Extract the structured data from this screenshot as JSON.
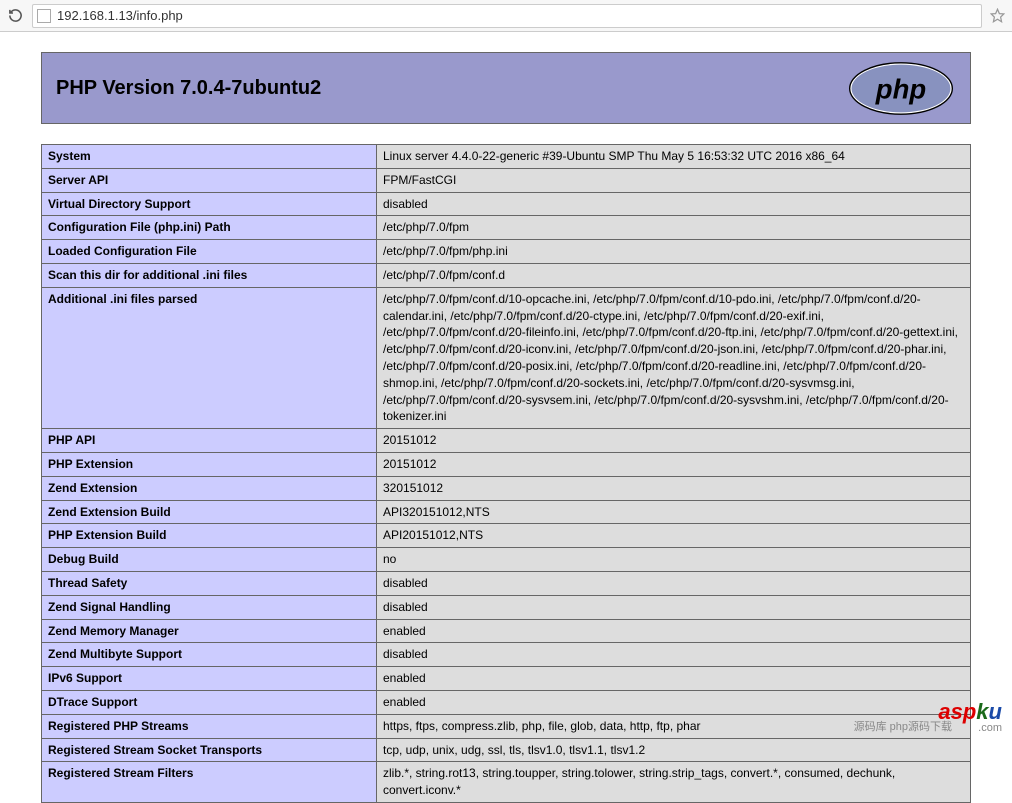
{
  "browser": {
    "url": "192.168.1.13/info.php"
  },
  "header": {
    "title": "PHP Version 7.0.4-7ubuntu2"
  },
  "rows": [
    {
      "k": "System",
      "v": "Linux server 4.4.0-22-generic #39-Ubuntu SMP Thu May 5 16:53:32 UTC 2016 x86_64"
    },
    {
      "k": "Server API",
      "v": "FPM/FastCGI"
    },
    {
      "k": "Virtual Directory Support",
      "v": "disabled"
    },
    {
      "k": "Configuration File (php.ini) Path",
      "v": "/etc/php/7.0/fpm"
    },
    {
      "k": "Loaded Configuration File",
      "v": "/etc/php/7.0/fpm/php.ini"
    },
    {
      "k": "Scan this dir for additional .ini files",
      "v": "/etc/php/7.0/fpm/conf.d"
    },
    {
      "k": "Additional .ini files parsed",
      "v": "/etc/php/7.0/fpm/conf.d/10-opcache.ini, /etc/php/7.0/fpm/conf.d/10-pdo.ini, /etc/php/7.0/fpm/conf.d/20-calendar.ini, /etc/php/7.0/fpm/conf.d/20-ctype.ini, /etc/php/7.0/fpm/conf.d/20-exif.ini, /etc/php/7.0/fpm/conf.d/20-fileinfo.ini, /etc/php/7.0/fpm/conf.d/20-ftp.ini, /etc/php/7.0/fpm/conf.d/20-gettext.ini, /etc/php/7.0/fpm/conf.d/20-iconv.ini, /etc/php/7.0/fpm/conf.d/20-json.ini, /etc/php/7.0/fpm/conf.d/20-phar.ini, /etc/php/7.0/fpm/conf.d/20-posix.ini, /etc/php/7.0/fpm/conf.d/20-readline.ini, /etc/php/7.0/fpm/conf.d/20-shmop.ini, /etc/php/7.0/fpm/conf.d/20-sockets.ini, /etc/php/7.0/fpm/conf.d/20-sysvmsg.ini, /etc/php/7.0/fpm/conf.d/20-sysvsem.ini, /etc/php/7.0/fpm/conf.d/20-sysvshm.ini, /etc/php/7.0/fpm/conf.d/20-tokenizer.ini"
    },
    {
      "k": "PHP API",
      "v": "20151012"
    },
    {
      "k": "PHP Extension",
      "v": "20151012"
    },
    {
      "k": "Zend Extension",
      "v": "320151012"
    },
    {
      "k": "Zend Extension Build",
      "v": "API320151012,NTS"
    },
    {
      "k": "PHP Extension Build",
      "v": "API20151012,NTS"
    },
    {
      "k": "Debug Build",
      "v": "no"
    },
    {
      "k": "Thread Safety",
      "v": "disabled"
    },
    {
      "k": "Zend Signal Handling",
      "v": "disabled"
    },
    {
      "k": "Zend Memory Manager",
      "v": "enabled"
    },
    {
      "k": "Zend Multibyte Support",
      "v": "disabled"
    },
    {
      "k": "IPv6 Support",
      "v": "enabled"
    },
    {
      "k": "DTrace Support",
      "v": "enabled"
    },
    {
      "k": "Registered PHP Streams",
      "v": "https, ftps, compress.zlib, php, file, glob, data, http, ftp, phar"
    },
    {
      "k": "Registered Stream Socket Transports",
      "v": "tcp, udp, unix, udg, ssl, tls, tlsv1.0, tlsv1.1, tlsv1.2"
    },
    {
      "k": "Registered Stream Filters",
      "v": "zlib.*, string.rot13, string.toupper, string.tolower, string.strip_tags, convert.*, consumed, dechunk, convert.iconv.*"
    }
  ],
  "watermark": {
    "site": "aspku",
    "tld": ".com",
    "cn": "源码库 php源码下载"
  }
}
